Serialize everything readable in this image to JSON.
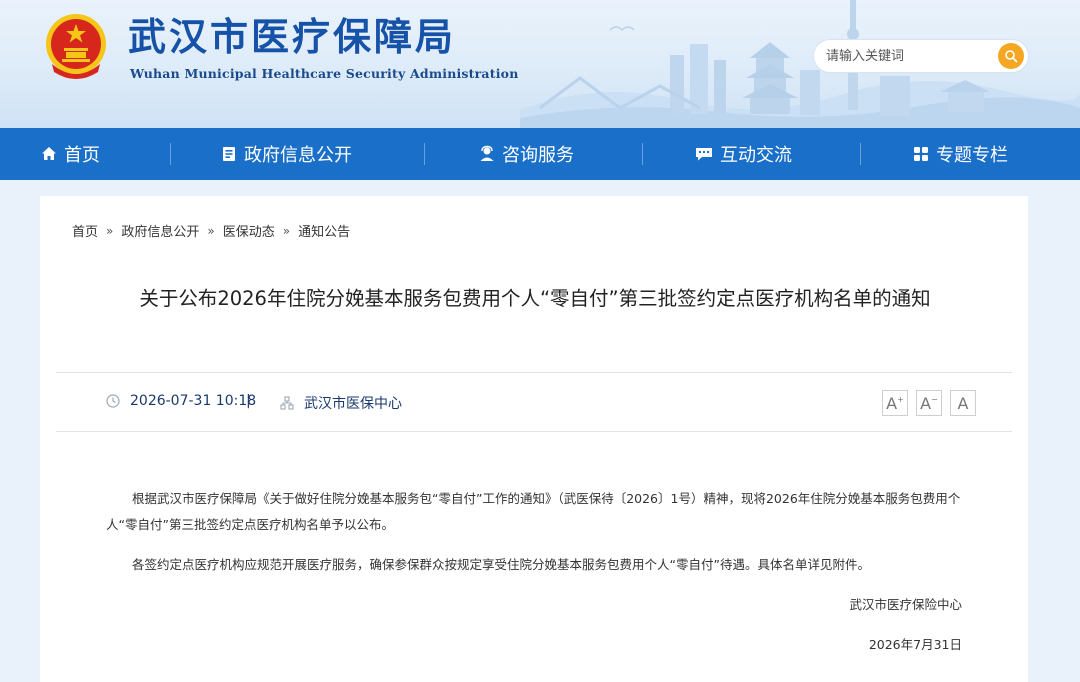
{
  "header": {
    "title": "武汉市医疗保障局",
    "subtitle": "Wuhan Municipal Healthcare Security Administration",
    "search_placeholder": "请输入关键词"
  },
  "nav": {
    "items": [
      {
        "label": "首页",
        "icon": "home-icon"
      },
      {
        "label": "政府信息公开",
        "icon": "document-icon"
      },
      {
        "label": "咨询服务",
        "icon": "consult-icon"
      },
      {
        "label": "互动交流",
        "icon": "chat-icon"
      },
      {
        "label": "专题专栏",
        "icon": "grid-icon"
      }
    ]
  },
  "breadcrumb": [
    "首页",
    "政府信息公开",
    "医保动态",
    "通知公告"
  ],
  "breadcrumb_sep": "»",
  "article": {
    "title": "关于公布2026年住院分娩基本服务包费用个人“零自付”第三批签约定点医疗机构名单的通知",
    "date": "2026-07-31 10:18",
    "divider": "|",
    "source": "武汉市医保中心",
    "font_sizes": [
      "A+",
      "A-",
      "A"
    ],
    "paragraphs": [
      "根据武汉市医疗保障局《关于做好住院分娩基本服务包“零自付”工作的通知》（武医保待〔2026〕1号）精神，现将2026年住院分娩基本服务包费用个人“零自付”第三批签约定点医疗机构名单予以公布。",
      "各签约定点医疗机构应规范开展医疗服务，确保参保群众按规定享受住院分娩基本服务包费用个人“零自付”待遇。具体名单详见附件。"
    ],
    "signature_org": "武汉市医疗保险中心",
    "signature_date": "2026年7月31日"
  },
  "colors": {
    "nav_bg": "#1a6fc9",
    "title_blue": "#1552a8",
    "search_button": "#f5a623",
    "emblem_red": "#d7261c",
    "emblem_gold": "#f5c518"
  }
}
